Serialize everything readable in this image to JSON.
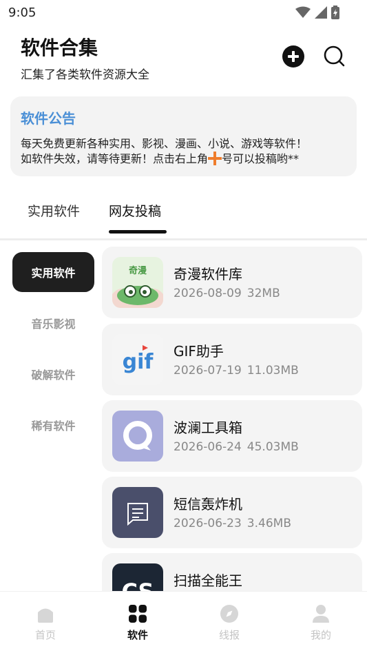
{
  "status": {
    "time": "9:05"
  },
  "header": {
    "title": "软件合集",
    "subtitle": "汇集了各类软件资源大全"
  },
  "notice": {
    "title": "软件公告",
    "line1": "每天免费更新各种实用、影视、漫画、小说、游戏等软件！",
    "line2_before": "如软件失效，请等待更新！点击右上角",
    "line2_after": "号可以投稿哟**"
  },
  "tabs": [
    {
      "label": "实用软件"
    },
    {
      "label": "网友投稿"
    }
  ],
  "categories": [
    {
      "label": "实用软件"
    },
    {
      "label": "音乐影视"
    },
    {
      "label": "破解软件"
    },
    {
      "label": "稀有软件"
    }
  ],
  "apps": [
    {
      "name": "奇漫软件库",
      "date": "2026-08-09",
      "size": "32MB",
      "icon_text": "奇漫"
    },
    {
      "name": "GIF助手",
      "date": "2026-07-19",
      "size": "11.03MB",
      "icon_text": "gif"
    },
    {
      "name": "波澜工具箱",
      "date": "2026-06-24",
      "size": "45.03MB"
    },
    {
      "name": "短信轰炸机",
      "date": "2026-06-23",
      "size": "3.46MB"
    },
    {
      "name": "扫描全能王",
      "icon_text": "CS"
    }
  ],
  "nav": [
    {
      "label": "首页"
    },
    {
      "label": "软件"
    },
    {
      "label": "线报"
    },
    {
      "label": "我的"
    }
  ],
  "colors": {
    "accent_blue": "#4a8fd6",
    "notice_plus": "#ef7d2c",
    "active_dark": "#1f1f1f"
  }
}
